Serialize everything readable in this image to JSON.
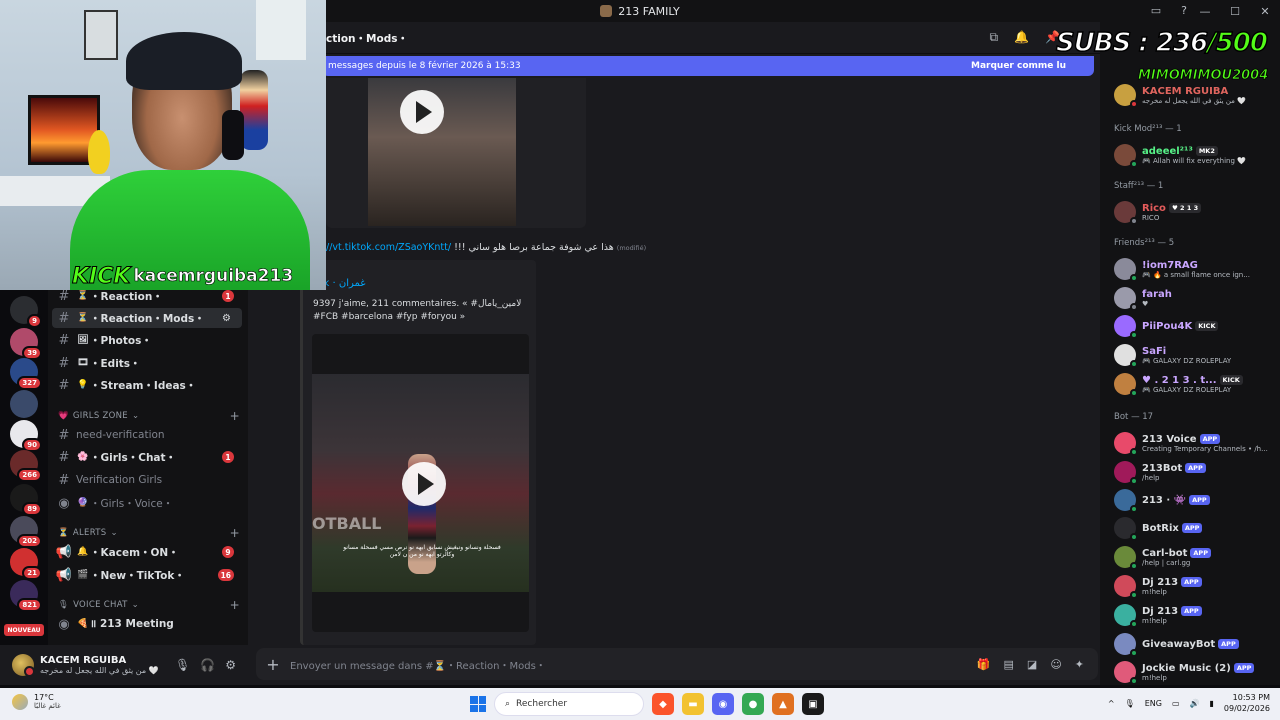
{
  "window": {
    "title": "213 FAMILY",
    "controls": [
      "—",
      "☐",
      "✕"
    ]
  },
  "channel_header": {
    "name": "ction・Mods・"
  },
  "new_messages_bar": {
    "text": "messages depuis le 8 février 2026 à 15:33",
    "action": "Marquer comme lu"
  },
  "sidebar": {
    "channels": [
      {
        "name": "・Reaction・",
        "emoji": "⏳",
        "badge": "1",
        "active": false,
        "muted": false
      },
      {
        "name": "・Reaction・Mods・",
        "emoji": "⏳",
        "badge": "",
        "active": true,
        "muted": false
      },
      {
        "name": "・Photos・",
        "emoji": "🖼",
        "badge": "",
        "active": false,
        "muted": false
      },
      {
        "name": "・Edits・",
        "emoji": "🎞",
        "badge": "",
        "active": false,
        "muted": false
      },
      {
        "name": "・Stream・Ideas・",
        "emoji": "💡",
        "badge": "",
        "active": false,
        "muted": false
      }
    ],
    "girls_zone": {
      "label": "GIRLS ZONE",
      "channels": [
        {
          "name": "need-verification",
          "emoji": "",
          "badge": "",
          "muted": true
        },
        {
          "name": "・Girls・Chat・",
          "emoji": "🌸",
          "badge": "1",
          "muted": false
        },
        {
          "name": "Verification Girls",
          "emoji": "",
          "badge": "",
          "muted": true
        },
        {
          "name": "・Girls・Voice・",
          "emoji": "🔮",
          "badge": "",
          "muted": true
        }
      ]
    },
    "alerts": {
      "label": "ALERTS",
      "channels": [
        {
          "name": "・Kacem・ON・",
          "emoji": "🔔",
          "badge": "9"
        },
        {
          "name": "・New・TikTok・",
          "emoji": "🎬",
          "badge": "16"
        }
      ]
    },
    "voice_chat": {
      "label": "VOICE CHAT",
      "channels": [
        {
          "name": "॥ 213 Meeting",
          "emoji": "🍕"
        }
      ]
    }
  },
  "servers": [
    {
      "badge": "9",
      "color": "#2b2d31"
    },
    {
      "badge": "39",
      "color": "#b04a6a"
    },
    {
      "badge": "327",
      "color": "#2a4a8a"
    },
    {
      "badge": "",
      "color": "#3a4a6a"
    },
    {
      "badge": "90",
      "color": "#e8e8ec"
    },
    {
      "badge": "266",
      "color": "#6a2a2a"
    },
    {
      "badge": "89",
      "color": "#1a1a1a"
    },
    {
      "badge": "202",
      "color": "#4a4a5a"
    },
    {
      "badge": "21",
      "color": "#d03030"
    },
    {
      "badge": "821",
      "color": "#3a2a5a"
    }
  ],
  "nouveau_label": "NOUVEAU",
  "user_panel": {
    "name": "KACEM RGUIBA",
    "status": "من يثق في الله يجعل له مخرجه 🤍"
  },
  "messages": {
    "link_text": "//vt.tiktok.com/ZSaoYKntt/",
    "text": "!!! هذا عي شوفة جماعة برصا هلو ساني",
    "edited": "(modifié)",
    "embed": {
      "provider": "k",
      "title": "Tok · غمران",
      "description": "9397 j'aime, 211 commentaires. « #لامين_يامال #FCB #barcelona #fyp #foryou »",
      "watermark": "OTBALL",
      "subtitle": "فسحلة ونسانو ونبغيش نسابق ابهه نو نرص مسي فسحلة مسانو وكالرتو ابهه نو من ن لامن"
    }
  },
  "composer": {
    "placeholder": "Envoyer un message dans #⏳・Reaction・Mods・"
  },
  "overlay": {
    "subs_label": "SUBS : ",
    "subs_count": "236",
    "subs_goal": "/500",
    "supporter": "MIMOMIMOU2004",
    "kick_label": "KICK",
    "kick_user": "kacemrguiba213"
  },
  "members": {
    "top_member": {
      "name": "KACEM RGUIBA",
      "activity": "من يثق في الله يجعل له مخرجه 🤍",
      "color": "#e0655e"
    },
    "groups": [
      {
        "label": "Kick Mod²¹³ — 1",
        "members": [
          {
            "name": "adeeel²¹³",
            "tag": "MK2",
            "activity": "🎮 Allah will fix everything 🤍",
            "color": "#57f287",
            "av": "#7a4a3a",
            "dot": "#23a55a"
          }
        ]
      },
      {
        "label": "Staff²¹³ — 1",
        "members": [
          {
            "name": "Rico",
            "tag": "♥ 2 1 3",
            "activity": "RICO",
            "color": "#e35b5b",
            "av": "#6a3a3a",
            "dot": "#80848e"
          }
        ]
      },
      {
        "label": "Friends²¹³ — 5",
        "members": [
          {
            "name": "!iom7RAG",
            "tag": "",
            "activity": "🎮 🔥 a small flame once ign...",
            "color": "#c9a6ff",
            "av": "#8a8a9a",
            "dot": "#23a55a"
          },
          {
            "name": "farah",
            "tag": "",
            "activity": "♥",
            "color": "#c9a6ff",
            "av": "#9a9aaa",
            "dot": "#80848e"
          },
          {
            "name": "PiiPou4K",
            "tag": "KICK",
            "activity": "",
            "color": "#c9a6ff",
            "av": "#9a6aff",
            "dot": "#23a55a"
          },
          {
            "name": "SaFi",
            "tag": "",
            "activity": "🎮 GALAXY DZ ROLEPLAY",
            "color": "#c9a6ff",
            "av": "#e0e0e0",
            "dot": "#23a55a"
          },
          {
            "name": "♥ . 2 1 3 . t...",
            "tag": "KICK",
            "activity": "🎮 GALAXY DZ ROLEPLAY",
            "color": "#c9a6ff",
            "av": "#c08040",
            "dot": "#23a55a"
          }
        ]
      },
      {
        "label": "Bot — 17",
        "members": [
          {
            "name": "213 Voice",
            "tag": "APP",
            "activity": "Creating Temporary Channels • /h...",
            "color": "#dbdee1",
            "av": "#e84a6a",
            "dot": "#23a55a"
          },
          {
            "name": "213Bot",
            "tag": "APP",
            "activity": "/help",
            "color": "#dbdee1",
            "av": "#a01a5a",
            "dot": "#23a55a"
          },
          {
            "name": "213 · 👾",
            "tag": "APP",
            "activity": "",
            "color": "#dbdee1",
            "av": "#3a6a9a",
            "dot": "#23a55a"
          },
          {
            "name": "BotRix",
            "tag": "APP",
            "activity": "",
            "color": "#dbdee1",
            "av": "#2a2a2e",
            "dot": "#23a55a"
          },
          {
            "name": "Carl-bot",
            "tag": "APP",
            "activity": "/help | carl.gg",
            "color": "#dbdee1",
            "av": "#6a8a3a",
            "dot": "#23a55a"
          },
          {
            "name": "Dj 213",
            "tag": "APP",
            "activity": "m!help",
            "color": "#dbdee1",
            "av": "#d04a5a",
            "dot": "#23a55a"
          },
          {
            "name": "Dj 213",
            "tag": "APP",
            "activity": "m!help",
            "color": "#dbdee1",
            "av": "#3ab0a0",
            "dot": "#23a55a"
          },
          {
            "name": "GiveawayBot",
            "tag": "APP",
            "activity": "",
            "color": "#dbdee1",
            "av": "#7a8ac0",
            "dot": "#23a55a"
          },
          {
            "name": "Jockie Music (2)",
            "tag": "APP",
            "activity": "m!help",
            "color": "#dbdee1",
            "av": "#e05a7a",
            "dot": "#23a55a"
          }
        ]
      }
    ]
  },
  "taskbar": {
    "temperature": "17°C",
    "weather_text": "غائم غالبًا",
    "search_label": "Rechercher",
    "lang": "ENG",
    "time": "10:53 PM",
    "date": "09/02/2026"
  }
}
